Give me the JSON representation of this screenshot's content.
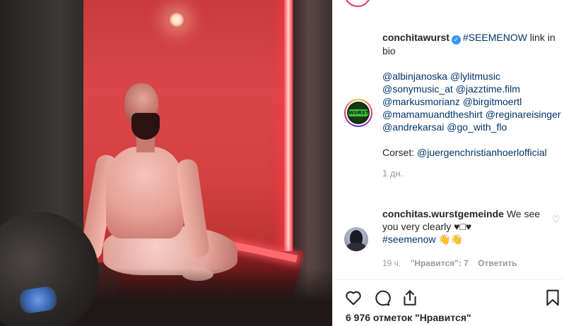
{
  "post": {
    "username": "conchitawurst",
    "caption_hashtag": "#SEEMENOW",
    "caption_after": " link in bio",
    "mentions": "@albinjanoska @lylitmusic @sonymusic_at @jazztime.film @markusmorianz @birgitmoertl @mamamuandtheshirt @reginareisinger @andrekarsai @go_with_flo",
    "corset_label": "Corset: ",
    "corset_mention": "@juergenchristianhoerlofficial",
    "time": "1 дн.",
    "avatar_logo": "WURST"
  },
  "comment": {
    "username": "conchitas.wurstgemeinde",
    "text": " We see you very clearly ♥□♥",
    "hashtag": "#seemenow",
    "emoji": " 👋👋",
    "time": "19 ч.",
    "likes": "\"Нравится\": 7",
    "reply": "Ответить"
  },
  "actions": {
    "like_icon": "heart-icon",
    "comment_icon": "comment-icon",
    "share_icon": "share-icon",
    "save_icon": "bookmark-icon",
    "likes_count": "6 976 отметок \"Нравится\""
  }
}
